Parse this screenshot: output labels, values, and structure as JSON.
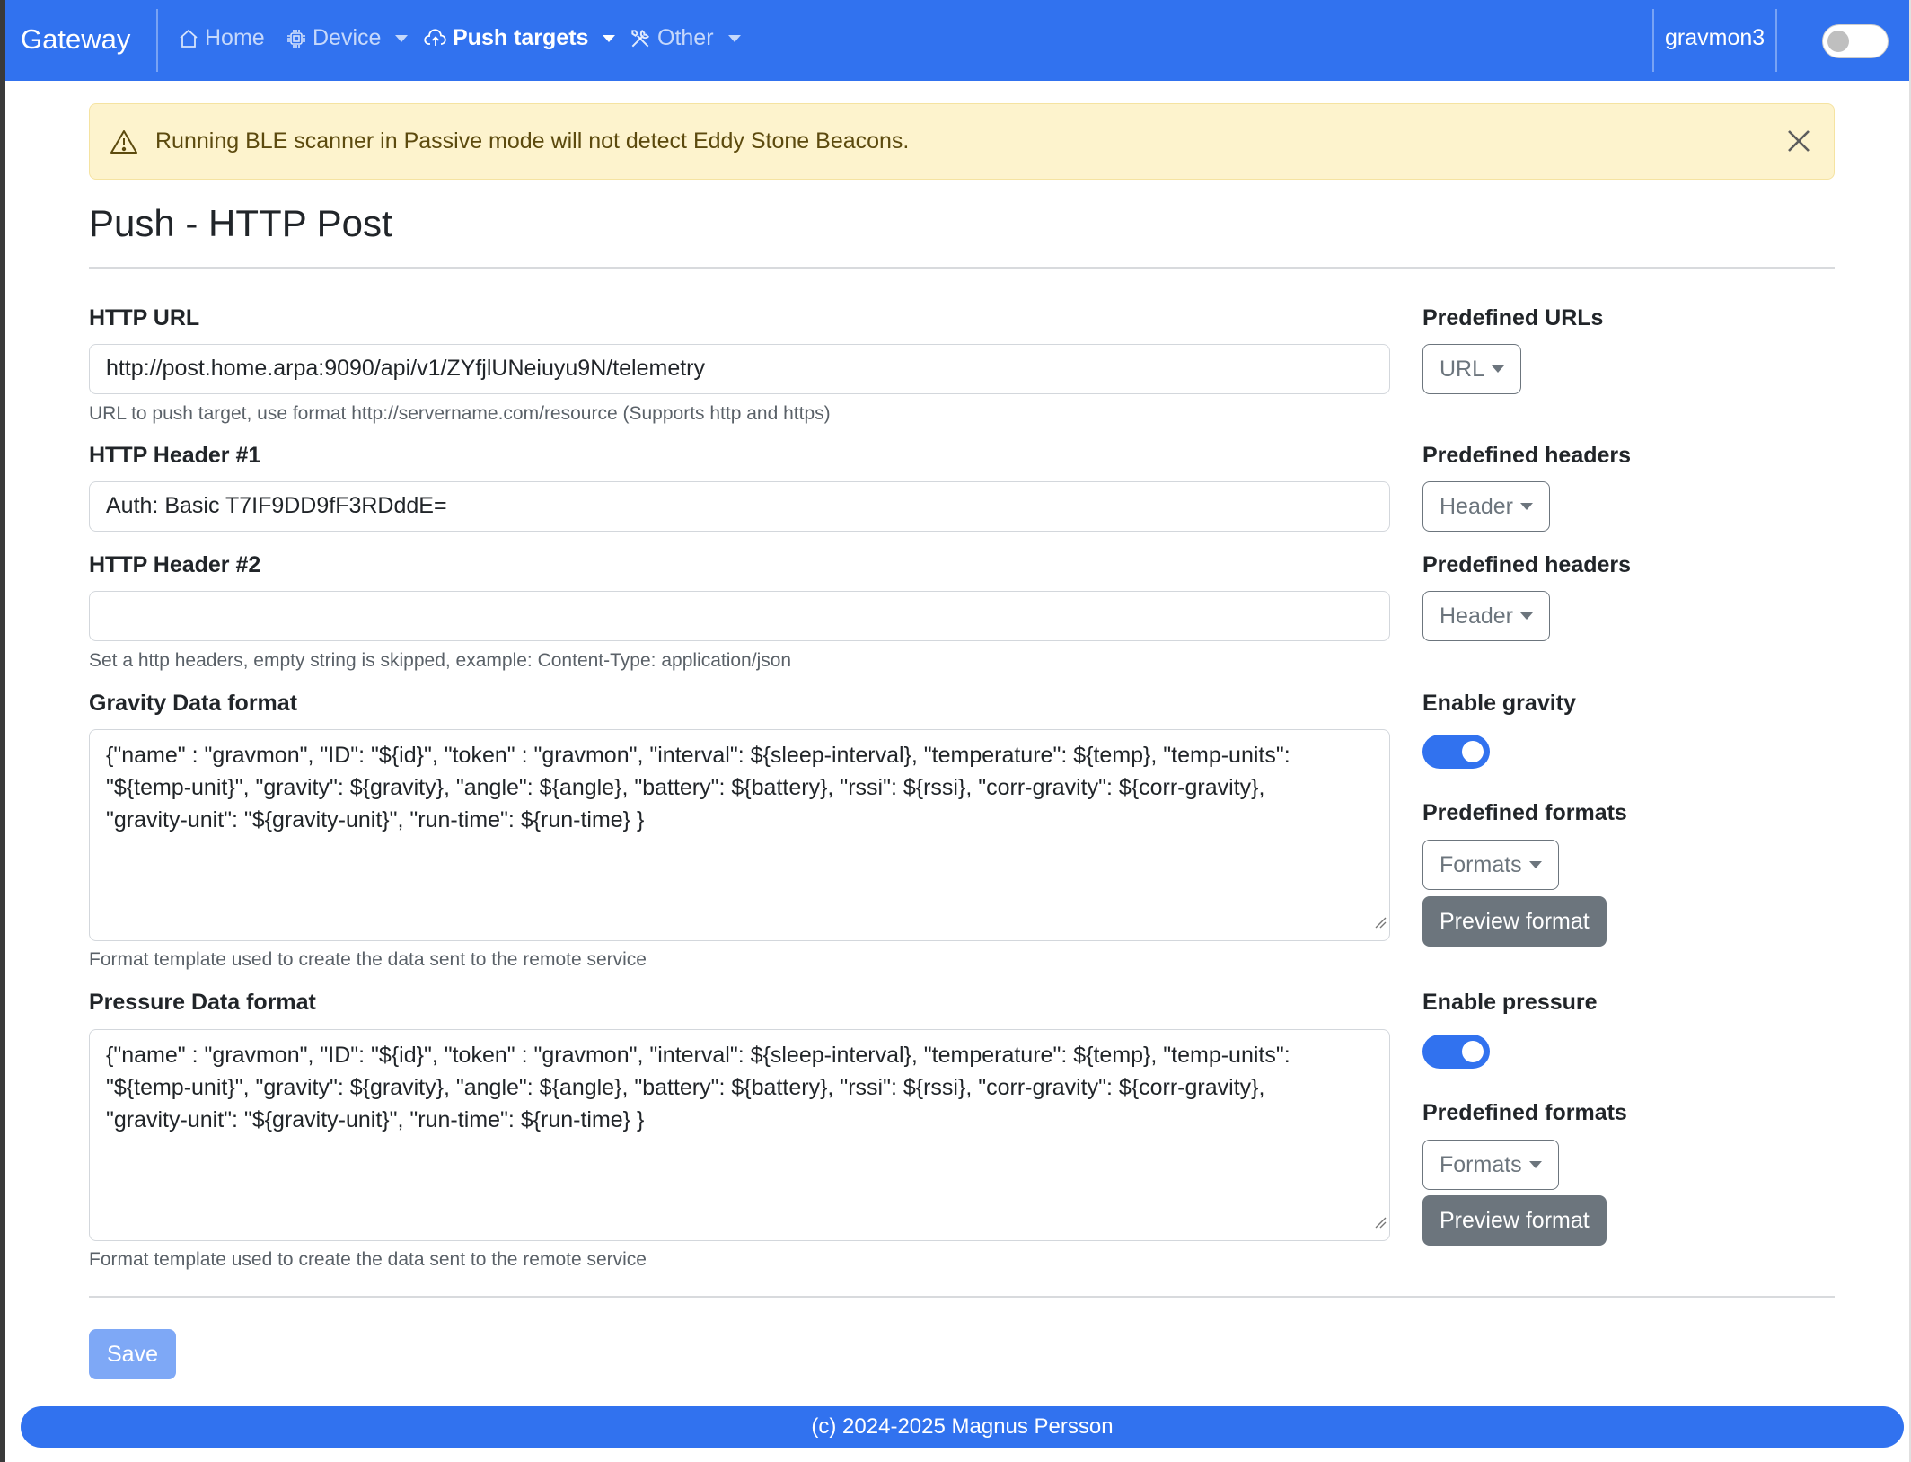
{
  "navbar": {
    "brand": "Gateway",
    "items": [
      {
        "label": "Home",
        "icon": "house-icon"
      },
      {
        "label": "Device",
        "icon": "cpu-icon"
      },
      {
        "label": "Push targets",
        "icon": "cloud-upload-icon"
      },
      {
        "label": "Other",
        "icon": "tools-icon"
      }
    ],
    "device_name": "gravmon3",
    "dark_mode_toggle": false,
    "colors": {
      "bar": "#3172ef"
    }
  },
  "alert": {
    "text": "Running BLE scanner in Passive mode will not detect Eddy Stone Beacons.",
    "icon": "warning-triangle-icon"
  },
  "page": {
    "title": "Push - HTTP Post"
  },
  "form": {
    "url": {
      "label": "HTTP URL",
      "value": "http://post.home.arpa:9090/api/v1/ZYfjlUNeiuyu9N/telemetry",
      "help": "URL to push target, use format http://servername.com/resource (Supports http and https)"
    },
    "predefined_urls": {
      "label": "Predefined URLs",
      "button": "URL"
    },
    "header1": {
      "label": "HTTP Header #1",
      "value": "Auth: Basic T7IF9DD9fF3RDddE="
    },
    "predefined_headers1": {
      "label": "Predefined headers",
      "button": "Header"
    },
    "header2": {
      "label": "HTTP Header #2",
      "value": "",
      "help": "Set a http headers, empty string is skipped, example: Content-Type: application/json"
    },
    "predefined_headers2": {
      "label": "Predefined headers",
      "button": "Header"
    },
    "gravity_format": {
      "label": "Gravity Data format",
      "lines": [
        "{\"name\" : \"gravmon\", \"ID\": \"${id}\", \"token\" : \"gravmon\", \"interval\": ${sleep-interval}, \"temperature\": ${temp}, \"temp-units\":",
        "\"${temp-unit}\", \"gravity\": ${gravity}, \"angle\": ${angle}, \"battery\": ${battery}, \"rssi\": ${rssi}, \"corr-gravity\": ${corr-gravity},",
        "\"gravity-unit\": \"${gravity-unit}\", \"run-time\": ${run-time} }"
      ],
      "help": "Format template used to create the data sent to the remote service"
    },
    "enable_gravity": {
      "label": "Enable gravity",
      "enabled": true
    },
    "predefined_formats_gravity": {
      "label": "Predefined formats",
      "button": "Formats",
      "preview": "Preview format"
    },
    "pressure_format": {
      "label": "Pressure Data format",
      "lines": [
        "{\"name\" : \"gravmon\", \"ID\": \"${id}\", \"token\" : \"gravmon\", \"interval\": ${sleep-interval}, \"temperature\": ${temp}, \"temp-units\":",
        "\"${temp-unit}\", \"gravity\": ${gravity}, \"angle\": ${angle}, \"battery\": ${battery}, \"rssi\": ${rssi}, \"corr-gravity\": ${corr-gravity},",
        "\"gravity-unit\": \"${gravity-unit}\", \"run-time\": ${run-time} }"
      ],
      "help": "Format template used to create the data sent to the remote service"
    },
    "enable_pressure": {
      "label": "Enable pressure",
      "enabled": true
    },
    "predefined_formats_pressure": {
      "label": "Predefined formats",
      "button": "Formats",
      "preview": "Preview format"
    },
    "save": "Save"
  },
  "footer": {
    "text": "(c) 2024-2025 Magnus Persson"
  }
}
